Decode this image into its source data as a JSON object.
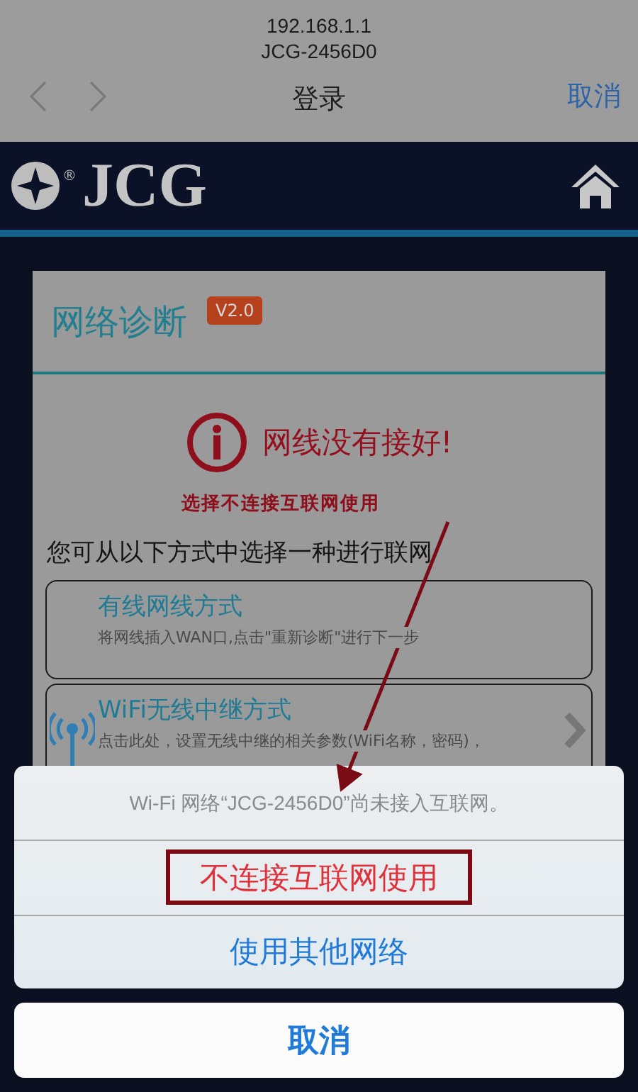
{
  "browser": {
    "url": "192.168.1.1",
    "network": "JCG-2456D0",
    "title": "登录",
    "cancel": "取消"
  },
  "header": {
    "logo_text": "JCG",
    "logo_mark": "®"
  },
  "card": {
    "title": "网络诊断",
    "badge": "V2.0",
    "alert": "网线没有接好!",
    "prompt": "您可从以下方式中选择一种进行联网",
    "options": [
      {
        "kind": "wired",
        "title": "有线网线方式",
        "description": "将网线插入WAN口,点击\"重新诊断\"进行下一步"
      },
      {
        "kind": "wifi",
        "title": "WiFi无线中继方式",
        "description": "点击此处，设置无线中继的相关参数(WiFi名称，密码)，"
      }
    ]
  },
  "annotation": {
    "text": "选择不连接互联网使用"
  },
  "action_sheet": {
    "message": "Wi-Fi 网络“JCG-2456D0”尚未接入互联网。",
    "actions": [
      {
        "label": "不连接互联网使用",
        "highlighted": true
      },
      {
        "label": "使用其他网络",
        "highlighted": false
      }
    ],
    "cancel": "取消"
  }
}
